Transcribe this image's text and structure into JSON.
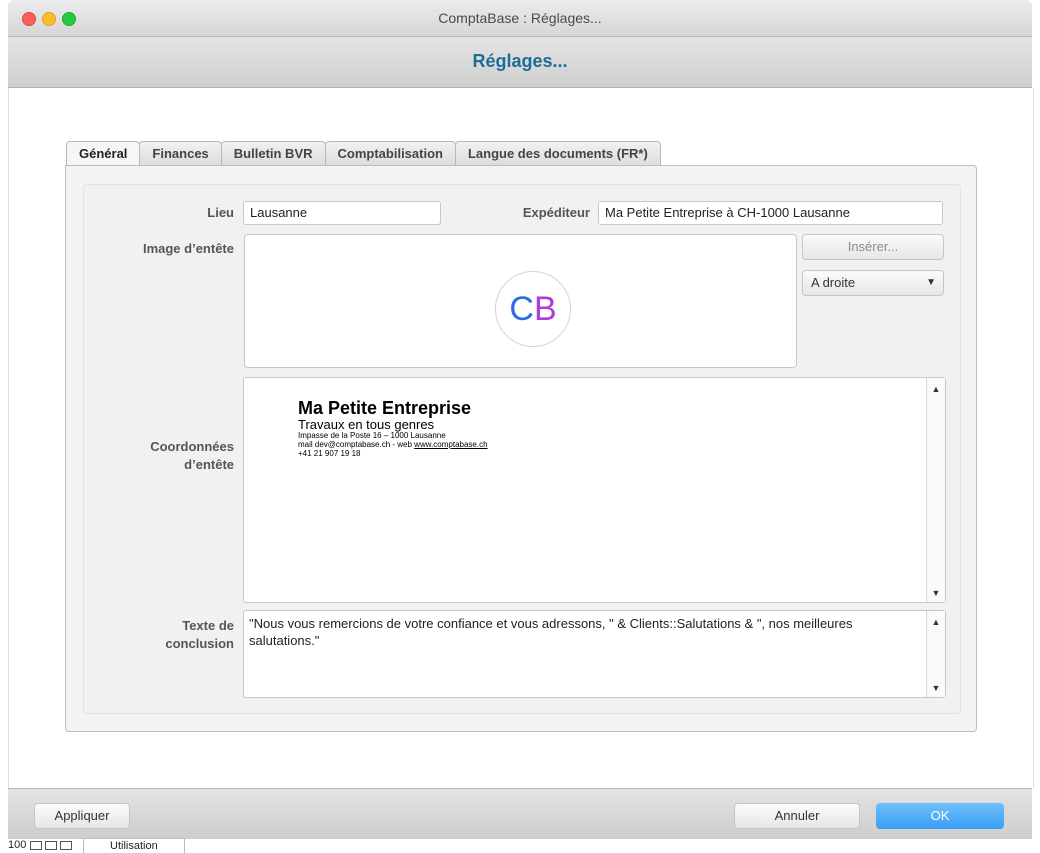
{
  "window": {
    "title": "ComptaBase : Réglages..."
  },
  "header": {
    "title": "Réglages..."
  },
  "tabs": [
    {
      "label": "Général",
      "active": true
    },
    {
      "label": "Finances",
      "active": false
    },
    {
      "label": "Bulletin BVR",
      "active": false
    },
    {
      "label": "Comptabilisation",
      "active": false
    },
    {
      "label": "Langue des documents (FR*)",
      "active": false
    }
  ],
  "form": {
    "lieu_label": "Lieu",
    "lieu_value": "Lausanne",
    "expediteur_label": "Expéditeur",
    "expediteur_value": "Ma Petite Entreprise à CH-1000 Lausanne",
    "image_label": "Image d’entête",
    "logo_text_c": "C",
    "logo_text_b": "B",
    "insert_button": "Insérer...",
    "position_select": "A droite",
    "coords_label_line1": "Coordonnées",
    "coords_label_line2": "d’entête",
    "coords": {
      "name": "Ma Petite Entreprise",
      "tagline": "Travaux en tous genres",
      "address": "Impasse de la Poste 16 – 1000 Lausanne",
      "mail_prefix": "mail dev@comptabase.ch - web ",
      "web": "www.comptabase.ch",
      "phone": "+41 21 907 19 18"
    },
    "conclusion_label_line1": "Texte de",
    "conclusion_label_line2": "conclusion",
    "conclusion_value": "\"Nous vous remercions de votre confiance et vous adressons, \" & Clients::Salutations & \", nos meilleures salutations.\""
  },
  "footer": {
    "apply_button": "Appliquer",
    "cancel_button": "Annuler",
    "ok_button": "OK"
  },
  "statusbar": {
    "zoom": "100",
    "mode": "Utilisation"
  },
  "colors": {
    "title_blue": "#1c6e97",
    "ok_blue": "#3a9ef5"
  }
}
